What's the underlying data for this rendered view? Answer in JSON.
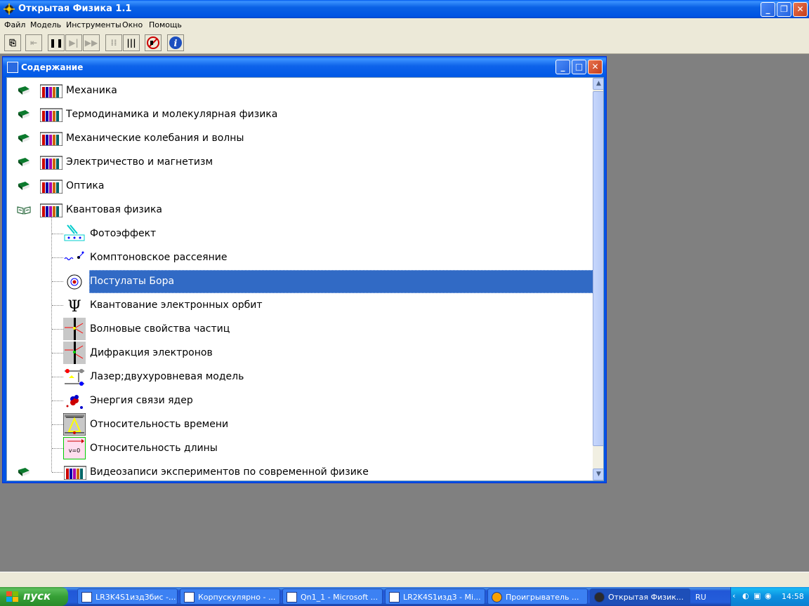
{
  "app": {
    "title": "Открытая Физика 1.1",
    "menu": [
      "Файл",
      "Модель",
      "Инструменты",
      "Окно",
      "Помощь"
    ]
  },
  "contents_window": {
    "title": "Содержание",
    "selected": "Постулаты Бора",
    "topics": [
      {
        "label": "Механика",
        "expanded": false
      },
      {
        "label": "Термодинамика и молекулярная физика",
        "expanded": false
      },
      {
        "label": "Механические колебания и волны",
        "expanded": false
      },
      {
        "label": "Электричество и магнетизм",
        "expanded": false
      },
      {
        "label": "Оптика",
        "expanded": false
      },
      {
        "label": "Квантовая физика",
        "expanded": true
      }
    ],
    "subtopics": [
      {
        "label": "Фотоэффект",
        "icon": "photoeffect-icon"
      },
      {
        "label": "Комптоновское рассеяние",
        "icon": "compton-icon"
      },
      {
        "label": "Постулаты Бора",
        "icon": "atom-target-icon"
      },
      {
        "label": "Квантование электронных орбит",
        "icon": "psi-icon"
      },
      {
        "label": "Волновые свойства частиц",
        "icon": "wave-particle-icon"
      },
      {
        "label": "Дифракция электронов",
        "icon": "diffraction-icon"
      },
      {
        "label": "Лазер;двухуровневая модель",
        "icon": "laser-icon"
      },
      {
        "label": "Энергия связи ядер",
        "icon": "nucleus-icon"
      },
      {
        "label": "Относительность времени",
        "icon": "time-relativity-icon"
      },
      {
        "label": "Относительность длины",
        "icon": "length-relativity-icon"
      }
    ],
    "last_topic": {
      "label": "Видеозаписи экспериментов по современной физике"
    }
  },
  "taskbar": {
    "start_label": "пуск",
    "tasks": [
      "LR3K4S1изд3бис -...",
      "Корпускулярно - ...",
      "Qn1_1 - Microsoft ...",
      "LR2K4S1изд3 - Mi...",
      "Проигрыватель ...",
      "Открытая Физик..."
    ],
    "language": "RU",
    "clock": "14:58"
  },
  "colors": {
    "titlebar": "#0054e3",
    "selection": "#316ac5",
    "workspace": "#808080",
    "taskbar": "#245edb",
    "start": "#36a036"
  }
}
